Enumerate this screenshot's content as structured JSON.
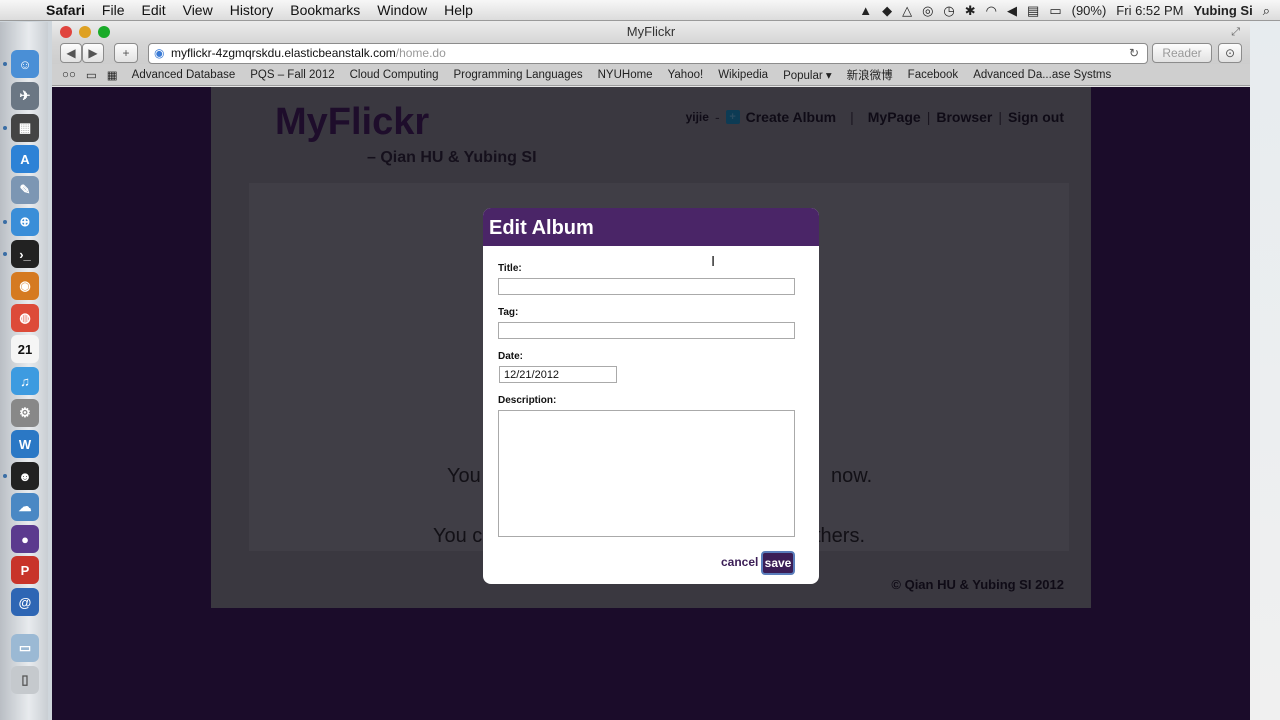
{
  "menubar": {
    "items": [
      "Safari",
      "File",
      "Edit",
      "View",
      "History",
      "Bookmarks",
      "Window",
      "Help"
    ],
    "battery": "(90%)",
    "clock": "Fri 6:52 PM",
    "user": "Yubing Si"
  },
  "window": {
    "title": "MyFlickr",
    "url_domain": "myflickr-4zgmqrskdu.elasticbeanstalk.com",
    "url_path": "/home.do",
    "reader_label": "Reader"
  },
  "bookmarks": [
    "Advanced Database",
    "PQS – Fall 2012",
    "Cloud Computing",
    "Programming Languages",
    "NYUHome",
    "Yahoo!",
    "Wikipedia",
    "Popular ▾",
    "新浪微博",
    "Facebook",
    "Advanced Da...ase Systms"
  ],
  "page": {
    "logo": "MyFlickr",
    "subtitle": "– Qian HU & Yubing SI",
    "nav": {
      "user": "yijie",
      "create": "Create Album",
      "mypage": "MyPage",
      "browser": "Browser",
      "signout": "Sign out"
    },
    "msg1_start": "You",
    "msg1_end": "now.",
    "msg2_start": "You c",
    "msg2_end": "thers.",
    "footer": "© Qian HU & Yubing SI 2012"
  },
  "modal": {
    "title": "Edit Album",
    "title_label": "Title:",
    "title_value": "",
    "tag_label": "Tag:",
    "tag_value": "",
    "date_label": "Date:",
    "date_value": "12/21/2012",
    "description_label": "Description:",
    "description_value": "",
    "cancel_label": "cancel",
    "save_label": "save"
  },
  "dock": {
    "calendar_day": "21"
  },
  "colors": {
    "header_purple": "#4a2567",
    "button_dark": "#3b1e56",
    "overlay_dark": "#1b0c2a"
  }
}
